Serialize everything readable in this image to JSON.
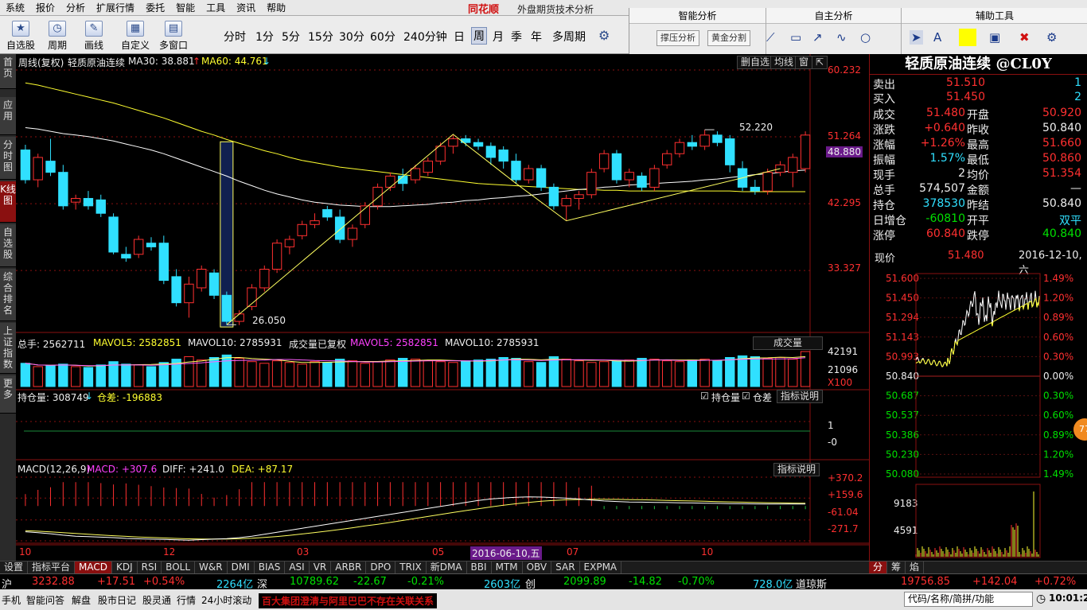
{
  "menu": {
    "items": [
      "系统",
      "报价",
      "分析",
      "扩展行情",
      "委托",
      "智能",
      "工具",
      "资讯",
      "帮助"
    ],
    "brand": "同花顺",
    "subtitle": "外盘期货技术分析"
  },
  "toolbar": {
    "buttons": [
      {
        "label": "自选股",
        "icon": "star-icon"
      },
      {
        "label": "周期",
        "icon": "clock-icon"
      },
      {
        "label": "画线",
        "icon": "pen-icon"
      },
      {
        "label": "自定义",
        "icon": "layout-icon"
      },
      {
        "label": "多窗口",
        "icon": "windows-icon"
      }
    ],
    "periods": [
      "分时",
      "1分",
      "5分",
      "15分",
      "30分",
      "60分",
      "240分钟",
      "日",
      "周",
      "月",
      "季",
      "年",
      "多周期"
    ],
    "active_period": "周"
  },
  "right_toolbar": {
    "sections": [
      {
        "title": "智能分析",
        "buttons": [
          "撑压分析",
          "黄金分割"
        ]
      },
      {
        "title": "自主分析"
      },
      {
        "title": "辅助工具"
      }
    ]
  },
  "left_tabs": [
    "首页",
    "应用",
    "分时图",
    "K线图",
    "自选股",
    "综合排名",
    "上证指数",
    "更多"
  ],
  "left_tab_active": "K线图",
  "kline": {
    "header_prefix": "周线(复权)",
    "name": "轻质原油连续",
    "ma30_label": "MA30: 38.881",
    "ma60_label": "MA60: 44.761",
    "panel_buttons": [
      "删自选",
      "均线",
      "窗"
    ],
    "price_axis": [
      "60.232",
      "51.264",
      "48.880",
      "42.295",
      "33.327"
    ],
    "high_label": "52.220",
    "low_label": "26.050",
    "date_axis": [
      "10",
      "12",
      "03",
      "05",
      "2016-06-10,五",
      "07",
      "10"
    ]
  },
  "volume": {
    "total_label": "总手: 2562711",
    "mavol5_label": "MAVOL5: 2582851",
    "mavol10_label": "MAVOL10: 2785931",
    "suffix_label": "成交量已复权",
    "mavol5b_label": "MAVOL5: 2582851",
    "mavol10b_label": "MAVOL10: 2785931",
    "button": "成交量",
    "axis": [
      "42191",
      "21096",
      "X100"
    ]
  },
  "oi": {
    "label": "持仓量: 308749",
    "diff_label": "仓差: -196883",
    "checkbox1": "持仓量",
    "checkbox2": "仓差",
    "button": "指标说明",
    "axis": [
      "1",
      "0",
      "-0"
    ]
  },
  "macd": {
    "label": "MACD(12,26,9)",
    "macd_label": "MACD: +307.6",
    "diff_label": "DIFF: +241.0",
    "dea_label": "DEA: +87.17",
    "button": "指标说明",
    "axis": [
      "+370.2",
      "+159.6",
      "-61.04",
      "-271.7"
    ]
  },
  "index_tabs": [
    "设置",
    "指标平台",
    "MACD",
    "KDJ",
    "RSI",
    "BOLL",
    "W&R",
    "DMI",
    "BIAS",
    "ASI",
    "VR",
    "ARBR",
    "DPO",
    "TRIX",
    "新DMA",
    "BBI",
    "MTM",
    "OBV",
    "SAR",
    "EXPMA"
  ],
  "index_tab_active": "MACD",
  "quote": {
    "title": "轻质原油连续 @CL0Y",
    "sell": {
      "label": "卖出",
      "price": "51.510",
      "qty": "1"
    },
    "buy": {
      "label": "买入",
      "price": "51.450",
      "qty": "2"
    },
    "rows": [
      {
        "l1": "成交",
        "v1": "51.480",
        "l2": "开盘",
        "v2": "50.920"
      },
      {
        "l1": "涨跌",
        "v1": "+0.640",
        "l2": "昨收",
        "v2": "50.840"
      },
      {
        "l1": "涨幅",
        "v1": "+1.26%",
        "l2": "最高",
        "v2": "51.660"
      },
      {
        "l1": "振幅",
        "v1": "1.57%",
        "l2": "最低",
        "v2": "50.860"
      },
      {
        "l1": "现手",
        "v1": "2",
        "l2": "均价",
        "v2": "51.354"
      },
      {
        "l1": "总手",
        "v1": "574,507",
        "l2": "金额",
        "v2": "—"
      },
      {
        "l1": "持仓",
        "v1": "378530",
        "l2": "昨结",
        "v2": "50.840"
      },
      {
        "l1": "日增仓",
        "v1": "-60810",
        "l2": "开平",
        "v2": "双平"
      },
      {
        "l1": "涨停",
        "v1": "60.840",
        "l2": "跌停",
        "v2": "40.840"
      }
    ],
    "now_label": "现价",
    "now_price": "51.480",
    "date": "2016-12-10,六"
  },
  "mini_chart": {
    "price_axis": [
      "51.600",
      "51.450",
      "51.294",
      "51.143",
      "50.993",
      "50.840",
      "50.687",
      "50.537",
      "50.386",
      "50.230",
      "50.080"
    ],
    "pct_axis": [
      "1.49%",
      "1.20%",
      "0.89%",
      "0.60%",
      "0.30%",
      "0.00%",
      "0.30%",
      "0.60%",
      "0.89%",
      "1.20%",
      "1.49%"
    ],
    "vol_axis": [
      "9183",
      "4591"
    ],
    "bubble": "77"
  },
  "info_tabs": [
    "分",
    "筹",
    "焰"
  ],
  "info_tab_active": "分",
  "ticker": {
    "sh_label": "沪",
    "sh_value": "3232.88",
    "sh_change": "+17.51",
    "sh_pct": "+0.54%",
    "sh_amount": "2264亿",
    "sz_label": "深",
    "sz_value": "10789.62",
    "sz_change": "-22.67",
    "sz_pct": "-0.21%",
    "cy_amount": "2603亿",
    "cy_label": "创",
    "cy_value": "2099.89",
    "cy_change": "-14.82",
    "cy_pct": "-0.70%",
    "dj_amount": "728.0亿",
    "dj_label": "道琼斯",
    "dj_value": "19756.85",
    "dj_change": "+142.04",
    "dj_pct": "+0.72%"
  },
  "status": {
    "items": [
      "手机",
      "智能问答",
      "解盘",
      "股市日记",
      "股灵通",
      "行情",
      "24小时滚动"
    ],
    "news": "百大集团澄清与阿里巴巴不存在关联关系",
    "search_placeholder": "代码/名称/简拼/功能",
    "clock": "10:01:26"
  },
  "colors": {
    "up": "#ff3030",
    "down": "#30e0ff",
    "ma30": "#ffffff",
    "ma60": "#ffff30",
    "background": "#000000"
  },
  "chart_data": {
    "type": "candlestick",
    "title": "轻质原油连续",
    "period": "weekly",
    "ylim": [
      26.05,
      60.232
    ],
    "candles": [
      {
        "o": 49.5,
        "h": 50.2,
        "l": 45.0,
        "c": 45.5
      },
      {
        "o": 45.5,
        "h": 49.0,
        "l": 44.5,
        "c": 48.5
      },
      {
        "o": 48.0,
        "h": 51.0,
        "l": 46.0,
        "c": 46.5
      },
      {
        "o": 46.5,
        "h": 47.5,
        "l": 41.5,
        "c": 42.0
      },
      {
        "o": 42.5,
        "h": 43.5,
        "l": 41.5,
        "c": 43.0
      },
      {
        "o": 43.0,
        "h": 44.0,
        "l": 41.5,
        "c": 42.0
      },
      {
        "o": 42.8,
        "h": 43.5,
        "l": 40.5,
        "c": 41.0
      },
      {
        "o": 40.5,
        "h": 41.0,
        "l": 35.5,
        "c": 35.8
      },
      {
        "o": 35.5,
        "h": 36.5,
        "l": 34.5,
        "c": 35.0
      },
      {
        "o": 35.5,
        "h": 38.0,
        "l": 35.0,
        "c": 37.5
      },
      {
        "o": 37.0,
        "h": 37.8,
        "l": 36.0,
        "c": 36.5
      },
      {
        "o": 37.0,
        "h": 38.0,
        "l": 31.5,
        "c": 32.0
      },
      {
        "o": 32.5,
        "h": 33.5,
        "l": 28.5,
        "c": 29.0
      },
      {
        "o": 29.0,
        "h": 32.5,
        "l": 27.0,
        "c": 31.5
      },
      {
        "o": 31.0,
        "h": 34.0,
        "l": 30.5,
        "c": 33.5
      },
      {
        "o": 33.0,
        "h": 33.5,
        "l": 29.5,
        "c": 30.0
      },
      {
        "o": 30.0,
        "h": 30.5,
        "l": 26.05,
        "c": 26.5
      },
      {
        "o": 26.5,
        "h": 28.0,
        "l": 26.0,
        "c": 27.5
      },
      {
        "o": 28.5,
        "h": 31.5,
        "l": 28.0,
        "c": 31.0
      },
      {
        "o": 31.0,
        "h": 34.0,
        "l": 30.5,
        "c": 33.5
      },
      {
        "o": 33.5,
        "h": 37.5,
        "l": 33.0,
        "c": 37.0
      },
      {
        "o": 36.5,
        "h": 38.0,
        "l": 35.5,
        "c": 37.5
      },
      {
        "o": 38.0,
        "h": 40.0,
        "l": 37.5,
        "c": 39.5
      },
      {
        "o": 39.5,
        "h": 41.0,
        "l": 39.0,
        "c": 40.0
      },
      {
        "o": 41.5,
        "h": 42.0,
        "l": 40.0,
        "c": 40.5
      },
      {
        "o": 40.5,
        "h": 41.5,
        "l": 37.0,
        "c": 37.5
      },
      {
        "o": 37.5,
        "h": 39.5,
        "l": 36.5,
        "c": 39.0
      },
      {
        "o": 39.5,
        "h": 42.5,
        "l": 39.0,
        "c": 42.0
      },
      {
        "o": 42.0,
        "h": 45.0,
        "l": 41.5,
        "c": 44.5
      },
      {
        "o": 44.5,
        "h": 46.5,
        "l": 44.0,
        "c": 46.0
      },
      {
        "o": 46.0,
        "h": 47.0,
        "l": 44.0,
        "c": 45.0
      },
      {
        "o": 45.5,
        "h": 47.5,
        "l": 45.0,
        "c": 47.0
      },
      {
        "o": 46.5,
        "h": 48.5,
        "l": 46.0,
        "c": 48.0
      },
      {
        "o": 48.0,
        "h": 50.5,
        "l": 47.5,
        "c": 50.0
      },
      {
        "o": 50.0,
        "h": 51.5,
        "l": 49.0,
        "c": 51.0
      },
      {
        "o": 51.0,
        "h": 51.5,
        "l": 50.0,
        "c": 50.5
      },
      {
        "o": 50.5,
        "h": 51.0,
        "l": 49.5,
        "c": 50.0
      },
      {
        "o": 50.0,
        "h": 50.5,
        "l": 47.5,
        "c": 48.5
      },
      {
        "o": 49.5,
        "h": 50.0,
        "l": 47.0,
        "c": 48.0
      },
      {
        "o": 48.0,
        "h": 49.0,
        "l": 45.0,
        "c": 45.5
      },
      {
        "o": 45.5,
        "h": 47.5,
        "l": 45.0,
        "c": 47.0
      },
      {
        "o": 47.0,
        "h": 47.5,
        "l": 44.0,
        "c": 44.5
      },
      {
        "o": 44.5,
        "h": 45.0,
        "l": 41.5,
        "c": 42.0
      },
      {
        "o": 42.0,
        "h": 43.5,
        "l": 40.0,
        "c": 43.0
      },
      {
        "o": 43.0,
        "h": 44.0,
        "l": 41.5,
        "c": 43.5
      },
      {
        "o": 43.5,
        "h": 47.0,
        "l": 43.0,
        "c": 46.5
      },
      {
        "o": 47.0,
        "h": 49.5,
        "l": 46.5,
        "c": 49.0
      },
      {
        "o": 49.0,
        "h": 49.5,
        "l": 45.0,
        "c": 45.5
      },
      {
        "o": 45.5,
        "h": 47.0,
        "l": 44.5,
        "c": 46.5
      },
      {
        "o": 46.0,
        "h": 46.5,
        "l": 44.0,
        "c": 44.5
      },
      {
        "o": 44.5,
        "h": 47.5,
        "l": 44.0,
        "c": 47.0
      },
      {
        "o": 47.5,
        "h": 49.5,
        "l": 47.0,
        "c": 49.0
      },
      {
        "o": 49.0,
        "h": 51.0,
        "l": 48.5,
        "c": 50.5
      },
      {
        "o": 50.5,
        "h": 51.5,
        "l": 49.5,
        "c": 50.0
      },
      {
        "o": 50.0,
        "h": 52.22,
        "l": 49.5,
        "c": 51.5
      },
      {
        "o": 51.5,
        "h": 52.0,
        "l": 50.0,
        "c": 50.5
      },
      {
        "o": 51.0,
        "h": 51.5,
        "l": 46.5,
        "c": 47.5
      },
      {
        "o": 47.0,
        "h": 48.0,
        "l": 44.0,
        "c": 44.5
      },
      {
        "o": 44.5,
        "h": 45.5,
        "l": 43.5,
        "c": 44.0
      },
      {
        "o": 44.0,
        "h": 47.0,
        "l": 43.5,
        "c": 46.5
      },
      {
        "o": 46.5,
        "h": 48.0,
        "l": 46.0,
        "c": 47.5
      },
      {
        "o": 46.5,
        "h": 49.0,
        "l": 44.5,
        "c": 48.5
      },
      {
        "o": 47.0,
        "h": 52.0,
        "l": 46.5,
        "c": 51.5
      }
    ],
    "ma30": [
      52.5,
      52.3,
      52.0,
      51.7,
      51.5,
      51.3,
      51.0,
      50.7,
      50.3,
      49.9,
      49.5,
      49.0,
      48.4,
      47.8,
      47.2,
      46.6,
      46.0,
      45.3,
      44.7,
      44.1,
      43.6,
      43.2,
      42.8,
      42.5,
      42.3,
      42.1,
      42.0,
      41.9,
      41.9,
      41.9,
      42.0,
      42.1,
      42.2,
      42.4,
      42.5,
      42.7,
      42.8,
      43.0,
      43.1,
      43.3,
      43.4,
      43.6,
      43.8,
      44.0,
      44.2,
      44.3,
      44.5,
      44.6,
      44.8,
      44.9,
      45.0,
      45.1,
      45.2,
      45.3,
      45.5,
      45.6,
      45.8,
      46.0,
      46.2,
      46.3,
      46.5,
      46.7,
      46.8
    ],
    "ma60": [
      58.5,
      58.2,
      57.8,
      57.4,
      57.0,
      56.6,
      56.2,
      55.8,
      55.3,
      54.8,
      54.3,
      53.8,
      53.2,
      52.6,
      52.0,
      51.5,
      50.9,
      50.4,
      49.9,
      49.4,
      49.0,
      48.5,
      48.1,
      47.8,
      47.5,
      47.2,
      47.0,
      46.8,
      46.6,
      46.4,
      46.2,
      46.0,
      45.8,
      45.6,
      45.4,
      45.2,
      45.0,
      44.9,
      44.8,
      44.7,
      44.6,
      44.5,
      44.4,
      44.3,
      44.2,
      44.2,
      44.1,
      44.1,
      44.0,
      44.0,
      44.0,
      44.0,
      44.0,
      44.0,
      44.0,
      44.0,
      44.0,
      43.9,
      43.9,
      43.9,
      43.9,
      43.9,
      43.9
    ],
    "volume": [
      28000,
      24000,
      25000,
      27000,
      24000,
      23000,
      26000,
      30000,
      27000,
      26000,
      24000,
      29000,
      33000,
      36000,
      32000,
      35000,
      38000,
      34000,
      30000,
      28000,
      31000,
      29000,
      27000,
      30000,
      29000,
      33000,
      31000,
      28000,
      30000,
      32000,
      34000,
      33000,
      31000,
      30000,
      29000,
      31000,
      32000,
      33000,
      35000,
      34000,
      30000,
      29000,
      36000,
      33000,
      31000,
      29000,
      30000,
      31000,
      32000,
      34000,
      33000,
      31000,
      30000,
      32000,
      33000,
      31000,
      35000,
      37000,
      36000,
      34000,
      35000,
      33000,
      42191
    ],
    "macd": {
      "diff": [
        -180,
        -190,
        -200,
        -215,
        -225,
        -230,
        -235,
        -240,
        -248,
        -252,
        -255,
        -258,
        -262,
        -265,
        -260,
        -255,
        -250,
        -240,
        -225,
        -205,
        -185,
        -165,
        -145,
        -125,
        -105,
        -85,
        -65,
        -45,
        -25,
        -5,
        15,
        35,
        55,
        75,
        95,
        115,
        135,
        150,
        160,
        168,
        172,
        170,
        165,
        158,
        150,
        140,
        130,
        125,
        120,
        118,
        116,
        114,
        112,
        110,
        108,
        106,
        104,
        102,
        101,
        100,
        100,
        100,
        100
      ],
      "dea": [
        -170,
        -175,
        -182,
        -190,
        -198,
        -206,
        -213,
        -220,
        -227,
        -233,
        -238,
        -243,
        -248,
        -252,
        -254,
        -254,
        -254,
        -251,
        -246,
        -238,
        -228,
        -216,
        -203,
        -188,
        -173,
        -157,
        -140,
        -122,
        -105,
        -86,
        -66,
        -46,
        -26,
        -6,
        14,
        33,
        52,
        70,
        87,
        102,
        116,
        127,
        136,
        142,
        145,
        147,
        147,
        146,
        144,
        142,
        139,
        136,
        133,
        130,
        127,
        124,
        121,
        118,
        115,
        113,
        111,
        109,
        108
      ],
      "bar_sign": [
        "+",
        "+",
        "+",
        "+",
        "+",
        "+",
        "+",
        "+",
        "+",
        "+",
        "+",
        "+",
        "+",
        "+",
        "+",
        "+",
        "+",
        "+",
        "+",
        "+",
        "+",
        "+",
        "+",
        "+",
        "+",
        "+",
        "+",
        "+",
        "+",
        "+",
        "+",
        "+",
        "+",
        "+",
        "+",
        "+",
        "+",
        "+",
        "+",
        "+",
        "+",
        "+",
        "+",
        "+",
        "+",
        "+",
        "-",
        "-",
        "-",
        "-",
        "-",
        "-",
        "-",
        "-",
        "-",
        "-",
        "-",
        "-",
        "-",
        "-",
        "-",
        "-",
        "-"
      ]
    },
    "xlabels": [
      "10",
      "12",
      "03",
      "05",
      "2016-06-10,五",
      "07",
      "10"
    ]
  }
}
